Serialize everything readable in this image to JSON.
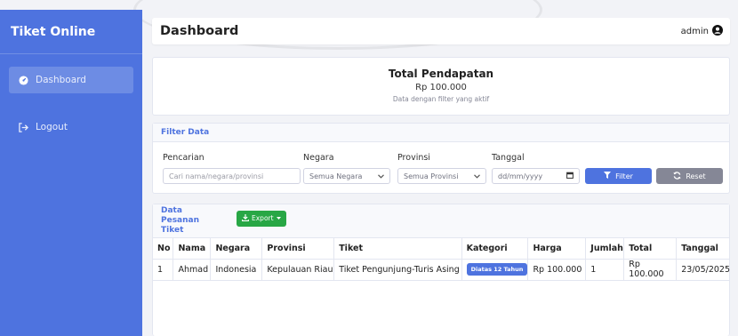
{
  "app": {
    "brand": "Tiket Online"
  },
  "sidebar": {
    "items": [
      {
        "label": "Dashboard",
        "icon": "dashboard-icon"
      },
      {
        "label": "Logout",
        "icon": "logout-icon"
      }
    ]
  },
  "header": {
    "title": "Dashboard",
    "user": "admin"
  },
  "revenue": {
    "title": "Total Pendapatan",
    "amount": "Rp 100.000",
    "note": "Data dengan filter yang aktif"
  },
  "filter": {
    "title": "Filter Data",
    "search_label": "Pencarian",
    "search_placeholder": "Cari nama/negara/provinsi",
    "negara_label": "Negara",
    "negara_value": "Semua Negara",
    "provinsi_label": "Provinsi",
    "provinsi_value": "Semua Provinsi",
    "tanggal_label": "Tanggal",
    "tanggal_value": "dd/mm/yyyy",
    "filter_button": "Filter",
    "reset_button": "Reset"
  },
  "orders": {
    "title": "Data Pesanan Tiket",
    "export_label": "Export",
    "columns": [
      "No",
      "Nama",
      "Negara",
      "Provinsi",
      "Tiket",
      "Kategori",
      "Harga",
      "Jumlah",
      "Total",
      "Tanggal"
    ],
    "rows": [
      {
        "no": "1",
        "nama": "Ahmad",
        "negara": "Indonesia",
        "provinsi": "Kepulauan Riau",
        "tiket": "Tiket Pengunjung-Turis Asing",
        "kategori": "Diatas 12 Tahun",
        "harga": "Rp 100.000",
        "jumlah": "1",
        "total": "Rp 100.000",
        "tanggal": "23/05/2025"
      }
    ]
  },
  "colors": {
    "primary": "#4e73df",
    "success": "#28a745",
    "secondary": "#858796"
  }
}
